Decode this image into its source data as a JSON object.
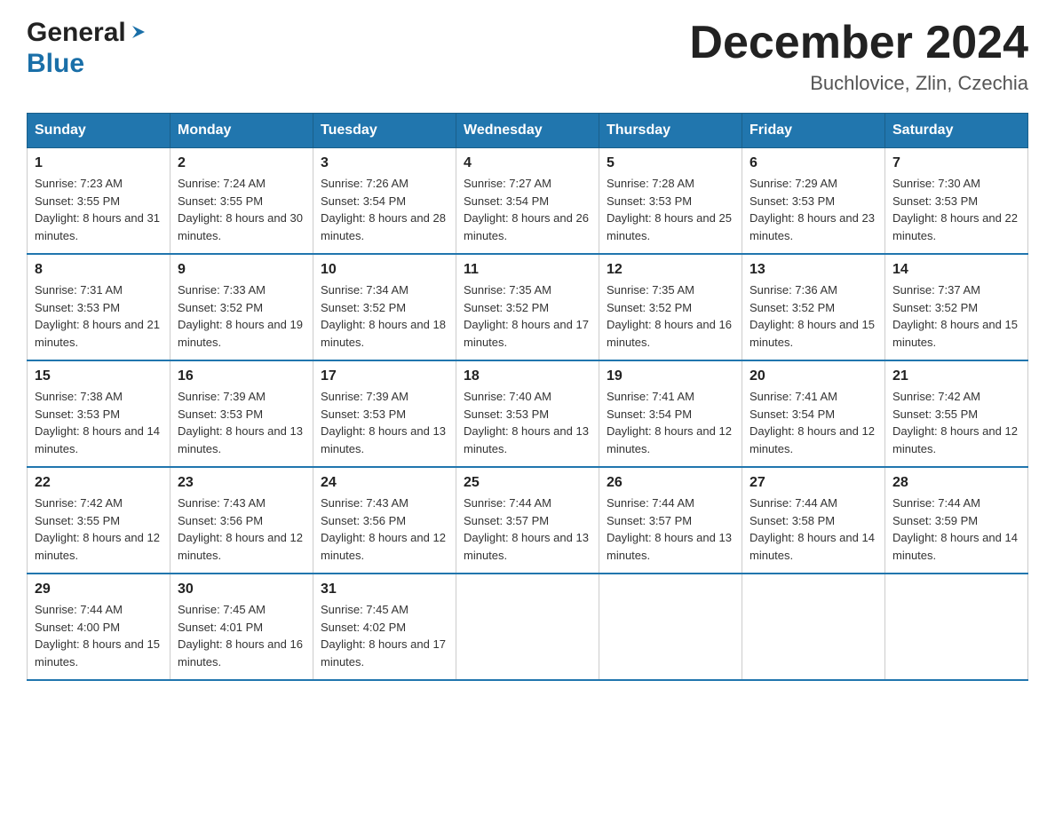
{
  "header": {
    "logo_general": "General",
    "logo_blue": "Blue",
    "title": "December 2024",
    "subtitle": "Buchlovice, Zlin, Czechia"
  },
  "columns": [
    "Sunday",
    "Monday",
    "Tuesday",
    "Wednesday",
    "Thursday",
    "Friday",
    "Saturday"
  ],
  "weeks": [
    [
      {
        "day": "1",
        "sunrise": "7:23 AM",
        "sunset": "3:55 PM",
        "daylight": "8 hours and 31 minutes."
      },
      {
        "day": "2",
        "sunrise": "7:24 AM",
        "sunset": "3:55 PM",
        "daylight": "8 hours and 30 minutes."
      },
      {
        "day": "3",
        "sunrise": "7:26 AM",
        "sunset": "3:54 PM",
        "daylight": "8 hours and 28 minutes."
      },
      {
        "day": "4",
        "sunrise": "7:27 AM",
        "sunset": "3:54 PM",
        "daylight": "8 hours and 26 minutes."
      },
      {
        "day": "5",
        "sunrise": "7:28 AM",
        "sunset": "3:53 PM",
        "daylight": "8 hours and 25 minutes."
      },
      {
        "day": "6",
        "sunrise": "7:29 AM",
        "sunset": "3:53 PM",
        "daylight": "8 hours and 23 minutes."
      },
      {
        "day": "7",
        "sunrise": "7:30 AM",
        "sunset": "3:53 PM",
        "daylight": "8 hours and 22 minutes."
      }
    ],
    [
      {
        "day": "8",
        "sunrise": "7:31 AM",
        "sunset": "3:53 PM",
        "daylight": "8 hours and 21 minutes."
      },
      {
        "day": "9",
        "sunrise": "7:33 AM",
        "sunset": "3:52 PM",
        "daylight": "8 hours and 19 minutes."
      },
      {
        "day": "10",
        "sunrise": "7:34 AM",
        "sunset": "3:52 PM",
        "daylight": "8 hours and 18 minutes."
      },
      {
        "day": "11",
        "sunrise": "7:35 AM",
        "sunset": "3:52 PM",
        "daylight": "8 hours and 17 minutes."
      },
      {
        "day": "12",
        "sunrise": "7:35 AM",
        "sunset": "3:52 PM",
        "daylight": "8 hours and 16 minutes."
      },
      {
        "day": "13",
        "sunrise": "7:36 AM",
        "sunset": "3:52 PM",
        "daylight": "8 hours and 15 minutes."
      },
      {
        "day": "14",
        "sunrise": "7:37 AM",
        "sunset": "3:52 PM",
        "daylight": "8 hours and 15 minutes."
      }
    ],
    [
      {
        "day": "15",
        "sunrise": "7:38 AM",
        "sunset": "3:53 PM",
        "daylight": "8 hours and 14 minutes."
      },
      {
        "day": "16",
        "sunrise": "7:39 AM",
        "sunset": "3:53 PM",
        "daylight": "8 hours and 13 minutes."
      },
      {
        "day": "17",
        "sunrise": "7:39 AM",
        "sunset": "3:53 PM",
        "daylight": "8 hours and 13 minutes."
      },
      {
        "day": "18",
        "sunrise": "7:40 AM",
        "sunset": "3:53 PM",
        "daylight": "8 hours and 13 minutes."
      },
      {
        "day": "19",
        "sunrise": "7:41 AM",
        "sunset": "3:54 PM",
        "daylight": "8 hours and 12 minutes."
      },
      {
        "day": "20",
        "sunrise": "7:41 AM",
        "sunset": "3:54 PM",
        "daylight": "8 hours and 12 minutes."
      },
      {
        "day": "21",
        "sunrise": "7:42 AM",
        "sunset": "3:55 PM",
        "daylight": "8 hours and 12 minutes."
      }
    ],
    [
      {
        "day": "22",
        "sunrise": "7:42 AM",
        "sunset": "3:55 PM",
        "daylight": "8 hours and 12 minutes."
      },
      {
        "day": "23",
        "sunrise": "7:43 AM",
        "sunset": "3:56 PM",
        "daylight": "8 hours and 12 minutes."
      },
      {
        "day": "24",
        "sunrise": "7:43 AM",
        "sunset": "3:56 PM",
        "daylight": "8 hours and 12 minutes."
      },
      {
        "day": "25",
        "sunrise": "7:44 AM",
        "sunset": "3:57 PM",
        "daylight": "8 hours and 13 minutes."
      },
      {
        "day": "26",
        "sunrise": "7:44 AM",
        "sunset": "3:57 PM",
        "daylight": "8 hours and 13 minutes."
      },
      {
        "day": "27",
        "sunrise": "7:44 AM",
        "sunset": "3:58 PM",
        "daylight": "8 hours and 14 minutes."
      },
      {
        "day": "28",
        "sunrise": "7:44 AM",
        "sunset": "3:59 PM",
        "daylight": "8 hours and 14 minutes."
      }
    ],
    [
      {
        "day": "29",
        "sunrise": "7:44 AM",
        "sunset": "4:00 PM",
        "daylight": "8 hours and 15 minutes."
      },
      {
        "day": "30",
        "sunrise": "7:45 AM",
        "sunset": "4:01 PM",
        "daylight": "8 hours and 16 minutes."
      },
      {
        "day": "31",
        "sunrise": "7:45 AM",
        "sunset": "4:02 PM",
        "daylight": "8 hours and 17 minutes."
      },
      null,
      null,
      null,
      null
    ]
  ],
  "labels": {
    "sunrise": "Sunrise:",
    "sunset": "Sunset:",
    "daylight": "Daylight:"
  }
}
